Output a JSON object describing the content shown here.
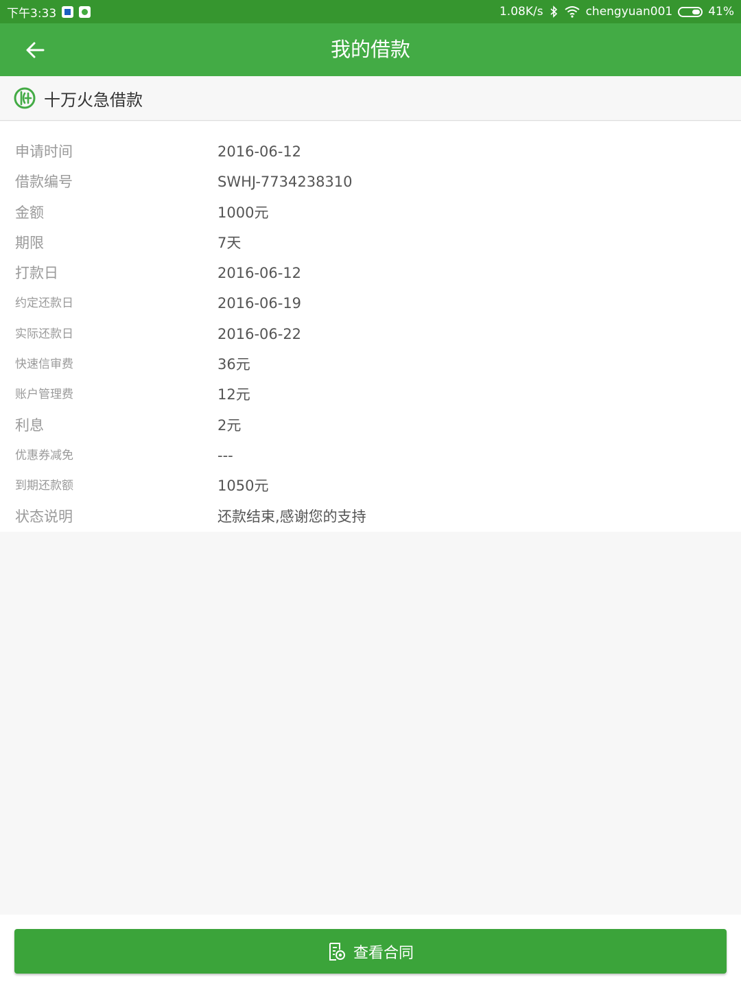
{
  "status_bar": {
    "time": "下午3:33",
    "net_speed": "1.08K/s",
    "wifi_name": "chengyuan001",
    "battery": "41%",
    "battery_level": 0.41
  },
  "header": {
    "title": "我的借款"
  },
  "product": {
    "name": "十万火急借款"
  },
  "details": [
    {
      "label": "申请时间",
      "value": "2016-06-12"
    },
    {
      "label": "借款编号",
      "value": "SWHJ-7734238310"
    },
    {
      "label": "金额",
      "value": "1000元"
    },
    {
      "label": "期限",
      "value": "7天"
    },
    {
      "label": "打款日",
      "value": "2016-06-12"
    },
    {
      "label": "约定还款日",
      "value": "2016-06-19"
    },
    {
      "label": "实际还款日",
      "value": "2016-06-22"
    },
    {
      "label": "快速信审费",
      "value": "36元"
    },
    {
      "label": "账户管理费",
      "value": "12元"
    },
    {
      "label": "利息",
      "value": "2元"
    },
    {
      "label": "优惠券减免",
      "value": "---"
    },
    {
      "label": "到期还款额",
      "value": "1050元"
    },
    {
      "label": "状态说明",
      "value": "还款结束,感谢您的支持"
    }
  ],
  "actions": {
    "view_contract": "查看合同"
  },
  "colors": {
    "status_bar": "#36962f",
    "header": "#43ab45",
    "button": "#3ba43a"
  }
}
